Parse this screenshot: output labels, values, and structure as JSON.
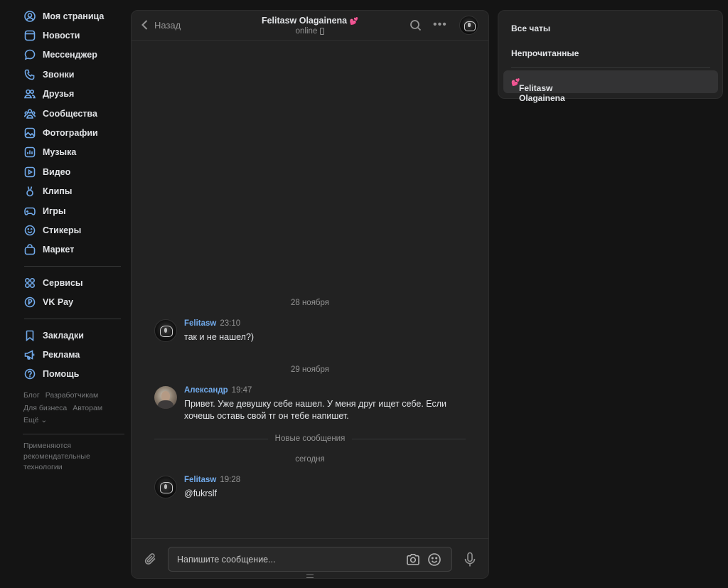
{
  "sidebar": {
    "items": [
      {
        "label": "Моя страница",
        "icon": "user-circle-icon"
      },
      {
        "label": "Новости",
        "icon": "newsfeed-icon"
      },
      {
        "label": "Мессенджер",
        "icon": "message-icon"
      },
      {
        "label": "Звонки",
        "icon": "phone-icon"
      },
      {
        "label": "Друзья",
        "icon": "friends-icon"
      },
      {
        "label": "Сообщества",
        "icon": "communities-icon"
      },
      {
        "label": "Фотографии",
        "icon": "photo-icon"
      },
      {
        "label": "Музыка",
        "icon": "music-icon"
      },
      {
        "label": "Видео",
        "icon": "video-icon"
      },
      {
        "label": "Клипы",
        "icon": "clips-icon"
      },
      {
        "label": "Игры",
        "icon": "gamepad-icon"
      },
      {
        "label": "Стикеры",
        "icon": "smile-icon"
      },
      {
        "label": "Маркет",
        "icon": "bag-icon"
      }
    ],
    "items2": [
      {
        "label": "Сервисы",
        "icon": "services-icon"
      },
      {
        "label": "VK Pay",
        "icon": "vkpay-icon"
      }
    ],
    "items3": [
      {
        "label": "Закладки",
        "icon": "bookmark-icon"
      },
      {
        "label": "Реклама",
        "icon": "megaphone-icon"
      },
      {
        "label": "Помощь",
        "icon": "help-icon"
      }
    ],
    "footer": {
      "blog": "Блог",
      "developers": "Разработчикам",
      "business": "Для бизнеса",
      "authors": "Авторам",
      "more": "Ещё ⌄"
    },
    "note": "Применяются рекомендательные технологии"
  },
  "chat": {
    "back_label": "Назад",
    "peer_name": "Felitasw Olagainena",
    "peer_heart": "💕",
    "peer_status": "online",
    "days": {
      "d1": "28 ноября",
      "d2": "29 ноября",
      "d3": "сегодня"
    },
    "messages": [
      {
        "author": "Felitasw",
        "time": "23:10",
        "text": "так и не нашел?)"
      },
      {
        "author": "Александр",
        "time": "19:47",
        "text": "Привет. Уже девушку себе нашел. У меня друг ищет себе. Если хочешь оставь свой тг он тебе напишет."
      },
      {
        "author": "Felitasw",
        "time": "19:28",
        "text": "@fukrslf"
      }
    ],
    "new_messages_label": "Новые сообщения",
    "input_placeholder": "Напишите сообщение..."
  },
  "right_panel": {
    "all_chats": "Все чаты",
    "unread": "Непрочитанные",
    "chat_name": "Felitasw Olagainena",
    "chat_heart": "💕"
  },
  "colors": {
    "accent": "#71aaeb",
    "background": "#141414",
    "panel": "#222222"
  }
}
